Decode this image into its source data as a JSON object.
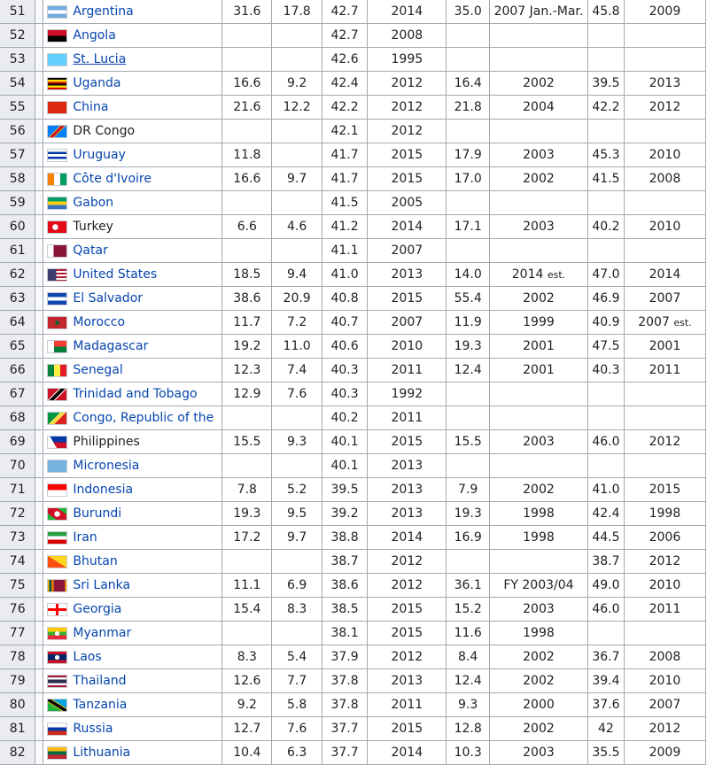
{
  "rows": [
    {
      "rank": "51",
      "country": "Argentina",
      "flag": "linear-gradient(#74acdf 33%, #ffffff 33%, #ffffff 67%, #74acdf 67%)",
      "c1": "31.6",
      "c2": "17.8",
      "c3": "42.7",
      "c4": "2014",
      "c5": "35.0",
      "c6": "2007 Jan.-Mar.",
      "c6note": "",
      "c7": "45.8",
      "c8": "2009",
      "c8note": ""
    },
    {
      "rank": "52",
      "country": "Angola",
      "flag": "linear-gradient(#ce1126 50%, #000000 50%)",
      "c1": "",
      "c2": "",
      "c3": "42.7",
      "c4": "2008",
      "c5": "",
      "c6": "",
      "c6note": "",
      "c7": "",
      "c8": "",
      "c8note": ""
    },
    {
      "rank": "53",
      "country": "St. Lucia",
      "flag": "linear-gradient(#65cfff, #65cfff)",
      "c1": "",
      "c2": "",
      "c3": "42.6",
      "c4": "1995",
      "c5": "",
      "c6": "",
      "c6note": "",
      "c7": "",
      "c8": "",
      "c8note": ""
    },
    {
      "rank": "54",
      "country": "Uganda",
      "flag": "linear-gradient(#000000 17%, #fcdc04 17%, #fcdc04 33%, #d90000 33%, #d90000 50%, #000000 50%, #000000 67%, #fcdc04 67%, #fcdc04 83%, #d90000 83%)",
      "c1": "16.6",
      "c2": "9.2",
      "c3": "42.4",
      "c4": "2012",
      "c5": "16.4",
      "c6": "2002",
      "c6note": "",
      "c7": "39.5",
      "c8": "2013",
      "c8note": ""
    },
    {
      "rank": "55",
      "country": "China",
      "flag": "linear-gradient(#de2910, #de2910)",
      "c1": "21.6",
      "c2": "12.2",
      "c3": "42.2",
      "c4": "2012",
      "c5": "21.8",
      "c6": "2004",
      "c6note": "",
      "c7": "42.2",
      "c8": "2012",
      "c8note": ""
    },
    {
      "rank": "56",
      "country": "DR Congo",
      "flag": "linear-gradient(135deg, #007fff 40%, #f7d618 40%, #f7d618 44%, #ce1021 44%, #ce1021 56%, #f7d618 56%, #f7d618 60%, #007fff 60%)",
      "c1": "",
      "c2": "",
      "c3": "42.1",
      "c4": "2012",
      "c5": "",
      "c6": "",
      "c6note": "",
      "c7": "",
      "c8": "",
      "c8note": ""
    },
    {
      "rank": "57",
      "country": "Uruguay",
      "flag": "linear-gradient(#ffffff 20%, #0038a8 20%, #0038a8 40%, #ffffff 40%, #ffffff 60%, #0038a8 60%, #0038a8 80%, #ffffff 80%)",
      "c1": "11.8",
      "c2": "",
      "c3": "41.7",
      "c4": "2015",
      "c5": "17.9",
      "c6": "2003",
      "c6note": "",
      "c7": "45.3",
      "c8": "2010",
      "c8note": ""
    },
    {
      "rank": "58",
      "country": "Côte d'Ivoire",
      "flag": "linear-gradient(90deg, #f77f00 33%, #ffffff 33%, #ffffff 67%, #009e60 67%)",
      "c1": "16.6",
      "c2": "9.7",
      "c3": "41.7",
      "c4": "2015",
      "c5": "17.0",
      "c6": "2002",
      "c6note": "",
      "c7": "41.5",
      "c8": "2008",
      "c8note": ""
    },
    {
      "rank": "59",
      "country": "Gabon",
      "flag": "linear-gradient(#009e60 33%, #fcd116 33%, #fcd116 67%, #3a75c4 67%)",
      "c1": "",
      "c2": "",
      "c3": "41.5",
      "c4": "2005",
      "c5": "",
      "c6": "",
      "c6note": "",
      "c7": "",
      "c8": "",
      "c8note": ""
    },
    {
      "rank": "60",
      "country": "Turkey",
      "flag": "radial-gradient(circle at 40% 50%, #ffffff 22%, #e30a17 24%)",
      "c1": "6.6",
      "c2": "4.6",
      "c3": "41.2",
      "c4": "2014",
      "c5": "17.1",
      "c6": "2003",
      "c6note": "",
      "c7": "40.2",
      "c8": "2010",
      "c8note": ""
    },
    {
      "rank": "61",
      "country": "Qatar",
      "flag": "linear-gradient(90deg, #ffffff 30%, #8a1538 30%)",
      "c1": "",
      "c2": "",
      "c3": "41.1",
      "c4": "2007",
      "c5": "",
      "c6": "",
      "c6note": "",
      "c7": "",
      "c8": "",
      "c8note": ""
    },
    {
      "rank": "62",
      "country": "United States",
      "flag": "linear-gradient(90deg, #3c3b6e 45%, transparent 45%), repeating-linear-gradient(#b22234 0 2px, #ffffff 2px 4px)",
      "c1": "18.5",
      "c2": "9.4",
      "c3": "41.0",
      "c4": "2013",
      "c5": "14.0",
      "c6": "2014",
      "c6note": "est.",
      "c7": "47.0",
      "c8": "2014",
      "c8note": ""
    },
    {
      "rank": "63",
      "country": "El Salvador",
      "flag": "linear-gradient(#0f47af 33%, #ffffff 33%, #ffffff 67%, #0f47af 67%)",
      "c1": "38.6",
      "c2": "20.9",
      "c3": "40.8",
      "c4": "2015",
      "c5": "55.4",
      "c6": "2002",
      "c6note": "",
      "c7": "46.9",
      "c8": "2007",
      "c8note": ""
    },
    {
      "rank": "64",
      "country": "Morocco",
      "flag": "radial-gradient(circle, #006233 18%, #c1272d 20%)",
      "c1": "11.7",
      "c2": "7.2",
      "c3": "40.7",
      "c4": "2007",
      "c5": "11.9",
      "c6": "1999",
      "c6note": "",
      "c7": "40.9",
      "c8": "2007",
      "c8note": "est."
    },
    {
      "rank": "65",
      "country": "Madagascar",
      "flag": "linear-gradient(90deg, #ffffff 33%, transparent 33%), linear-gradient(#fc3d32 50%, #007e3a 50%)",
      "c1": "19.2",
      "c2": "11.0",
      "c3": "40.6",
      "c4": "2010",
      "c5": "19.3",
      "c6": "2001",
      "c6note": "",
      "c7": "47.5",
      "c8": "2001",
      "c8note": ""
    },
    {
      "rank": "66",
      "country": "Senegal",
      "flag": "linear-gradient(90deg, #00853f 33%, #fdef42 33%, #fdef42 67%, #e31b23 67%)",
      "c1": "12.3",
      "c2": "7.4",
      "c3": "40.3",
      "c4": "2011",
      "c5": "12.4",
      "c6": "2001",
      "c6note": "",
      "c7": "40.3",
      "c8": "2011",
      "c8note": ""
    },
    {
      "rank": "67",
      "country": "Trinidad and Tobago",
      "flag": "linear-gradient(135deg, #ce1126 38%, #ffffff 38%, #ffffff 42%, #000000 42%, #000000 58%, #ffffff 58%, #ffffff 62%, #ce1126 62%)",
      "c1": "12.9",
      "c2": "7.6",
      "c3": "40.3",
      "c4": "1992",
      "c5": "",
      "c6": "",
      "c6note": "",
      "c7": "",
      "c8": "",
      "c8note": ""
    },
    {
      "rank": "68",
      "country": "Congo, Republic of the",
      "flag": "linear-gradient(135deg, #009543 40%, #fbde4a 40%, #fbde4a 60%, #dc241f 60%)",
      "c1": "",
      "c2": "",
      "c3": "40.2",
      "c4": "2011",
      "c5": "",
      "c6": "",
      "c6note": "",
      "c7": "",
      "c8": "",
      "c8note": ""
    },
    {
      "rank": "69",
      "country": "Philippines",
      "flag": "linear-gradient(60deg, #ffffff 35%, transparent 35%), linear-gradient(#0038a8 50%, #ce1126 50%)",
      "c1": "15.5",
      "c2": "9.3",
      "c3": "40.1",
      "c4": "2015",
      "c5": "15.5",
      "c6": "2003",
      "c6note": "",
      "c7": "46.0",
      "c8": "2012",
      "c8note": ""
    },
    {
      "rank": "70",
      "country": "Micronesia",
      "flag": "linear-gradient(#75b2dd, #75b2dd)",
      "c1": "",
      "c2": "",
      "c3": "40.1",
      "c4": "2013",
      "c5": "",
      "c6": "",
      "c6note": "",
      "c7": "",
      "c8": "",
      "c8note": ""
    },
    {
      "rank": "71",
      "country": "Indonesia",
      "flag": "linear-gradient(#ff0000 50%, #ffffff 50%)",
      "c1": "7.8",
      "c2": "5.2",
      "c3": "39.5",
      "c4": "2013",
      "c5": "7.9",
      "c6": "2002",
      "c6note": "",
      "c7": "41.0",
      "c8": "2015",
      "c8note": ""
    },
    {
      "rank": "72",
      "country": "Burundi",
      "flag": "radial-gradient(circle, #ffffff 25%, transparent 27%), linear-gradient(35deg, #1eb53a 25%, #ce1126 25%, #ce1126 75%, #1eb53a 75%)",
      "c1": "19.3",
      "c2": "9.5",
      "c3": "39.2",
      "c4": "2013",
      "c5": "19.3",
      "c6": "1998",
      "c6note": "",
      "c7": "42.4",
      "c8": "1998",
      "c8note": ""
    },
    {
      "rank": "73",
      "country": "Iran",
      "flag": "linear-gradient(#239f40 33%, #ffffff 33%, #ffffff 67%, #da0000 67%)",
      "c1": "17.2",
      "c2": "9.7",
      "c3": "38.8",
      "c4": "2014",
      "c5": "16.9",
      "c6": "1998",
      "c6note": "",
      "c7": "44.5",
      "c8": "2006",
      "c8note": ""
    },
    {
      "rank": "74",
      "country": "Bhutan",
      "flag": "linear-gradient(to top right, #ff4e12 50%, #ffd520 50%)",
      "c1": "",
      "c2": "",
      "c3": "38.7",
      "c4": "2012",
      "c5": "",
      "c6": "",
      "c6note": "",
      "c7": "38.7",
      "c8": "2012",
      "c8note": ""
    },
    {
      "rank": "75",
      "country": "Sri Lanka",
      "flag": "linear-gradient(90deg, #ffb700 8%, #00534e 8%, #00534e 18%, #eb7400 18%, #eb7400 28%, #ffb700 28%, #ffb700 32%, #8d153a 32%, #8d153a 92%, #ffb700 92%)",
      "c1": "11.1",
      "c2": "6.9",
      "c3": "38.6",
      "c4": "2012",
      "c5": "36.1",
      "c6": "FY 2003/04",
      "c6note": "",
      "c7": "49.0",
      "c8": "2010",
      "c8note": ""
    },
    {
      "rank": "76",
      "country": "Georgia",
      "flag": "linear-gradient(90deg, transparent 42%, #ff0000 42%, #ff0000 58%, transparent 58%), linear-gradient(#ffffff 40%, #ff0000 40%, #ff0000 60%, #ffffff 60%)",
      "c1": "15.4",
      "c2": "8.3",
      "c3": "38.5",
      "c4": "2015",
      "c5": "15.2",
      "c6": "2003",
      "c6note": "",
      "c7": "46.0",
      "c8": "2011",
      "c8note": ""
    },
    {
      "rank": "77",
      "country": "Myanmar",
      "flag": "radial-gradient(circle, #ffffff 20%, transparent 22%), linear-gradient(#fecb00 33%, #34b233 33%, #34b233 67%, #ea2839 67%)",
      "c1": "",
      "c2": "",
      "c3": "38.1",
      "c4": "2015",
      "c5": "11.6",
      "c6": "1998",
      "c6note": "",
      "c7": "",
      "c8": "",
      "c8note": ""
    },
    {
      "rank": "78",
      "country": "Laos",
      "flag": "radial-gradient(circle, #ffffff 20%, transparent 22%), linear-gradient(#ce1126 25%, #002868 25%, #002868 75%, #ce1126 75%)",
      "c1": "8.3",
      "c2": "5.4",
      "c3": "37.9",
      "c4": "2012",
      "c5": "8.4",
      "c6": "2002",
      "c6note": "",
      "c7": "36.7",
      "c8": "2008",
      "c8note": ""
    },
    {
      "rank": "79",
      "country": "Thailand",
      "flag": "linear-gradient(#a51931 17%, #f4f5f8 17%, #f4f5f8 33%, #2d2a4a 33%, #2d2a4a 67%, #f4f5f8 67%, #f4f5f8 83%, #a51931 83%)",
      "c1": "12.6",
      "c2": "7.7",
      "c3": "37.8",
      "c4": "2013",
      "c5": "12.4",
      "c6": "2002",
      "c6note": "",
      "c7": "39.4",
      "c8": "2010",
      "c8note": ""
    },
    {
      "rank": "80",
      "country": "Tanzania",
      "flag": "linear-gradient(to top right, #1eb53a 38%, #fcd116 38%, #fcd116 42%, #000000 42%, #000000 58%, #fcd116 58%, #fcd116 62%, #00a3dd 62%)",
      "c1": "9.2",
      "c2": "5.8",
      "c3": "37.8",
      "c4": "2011",
      "c5": "9.3",
      "c6": "2000",
      "c6note": "",
      "c7": "37.6",
      "c8": "2007",
      "c8note": ""
    },
    {
      "rank": "81",
      "country": "Russia",
      "flag": "linear-gradient(#ffffff 33%, #0039a6 33%, #0039a6 67%, #d52b1e 67%)",
      "c1": "12.7",
      "c2": "7.6",
      "c3": "37.7",
      "c4": "2015",
      "c5": "12.8",
      "c6": "2002",
      "c6note": "",
      "c7": "42",
      "c8": "2012",
      "c8note": ""
    },
    {
      "rank": "82",
      "country": "Lithuania",
      "flag": "linear-gradient(#fdb913 33%, #006a44 33%, #006a44 67%, #c1272d 67%)",
      "c1": "10.4",
      "c2": "6.3",
      "c3": "37.7",
      "c4": "2014",
      "c5": "10.3",
      "c6": "2003",
      "c6note": "",
      "c7": "35.5",
      "c8": "2009",
      "c8note": ""
    }
  ],
  "link_colors": {
    "link": "#0645ad",
    "visited_dark": "#202122"
  }
}
